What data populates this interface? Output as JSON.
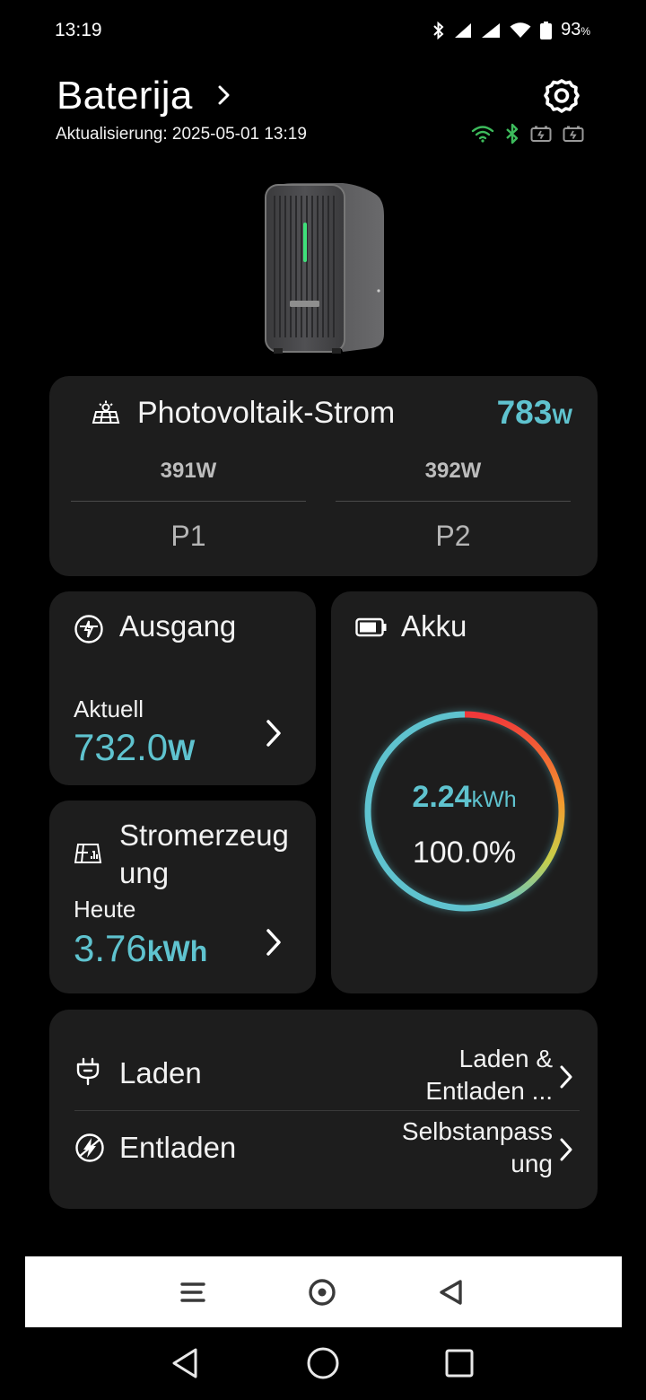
{
  "status_bar": {
    "time": "13:19",
    "battery_percent": "93",
    "battery_percent_sign": "%"
  },
  "header": {
    "title": "Baterija",
    "update_text": "Aktualisierung: 2025-05-01 13:19"
  },
  "pv": {
    "title": "Photovoltaik-Strom",
    "total_value": "783",
    "total_unit": "W",
    "channels": [
      {
        "value": "391W",
        "name": "P1"
      },
      {
        "value": "392W",
        "name": "P2"
      }
    ]
  },
  "output": {
    "title": "Ausgang",
    "sub_label": "Aktuell",
    "value": "732.0",
    "unit": "W"
  },
  "generation": {
    "title_line1": "Stromerzeug",
    "title_line2": "ung",
    "sub_label": "Heute",
    "value": "3.76",
    "unit": "kWh"
  },
  "battery": {
    "title": "Akku",
    "energy_value": "2.24",
    "energy_unit": "kWh",
    "percent_text": "100.0%",
    "level": 1.0
  },
  "modes": {
    "charge": {
      "label": "Laden",
      "value_line1": "Laden &",
      "value_line2": "Entladen ..."
    },
    "discharge": {
      "label": "Entladen",
      "value_line1": "Selbstanpass",
      "value_line2": "ung"
    }
  },
  "colors": {
    "accent": "#5fc3cf",
    "card_bg": "#1d1d1d",
    "status_green": "#3dbb5c"
  }
}
